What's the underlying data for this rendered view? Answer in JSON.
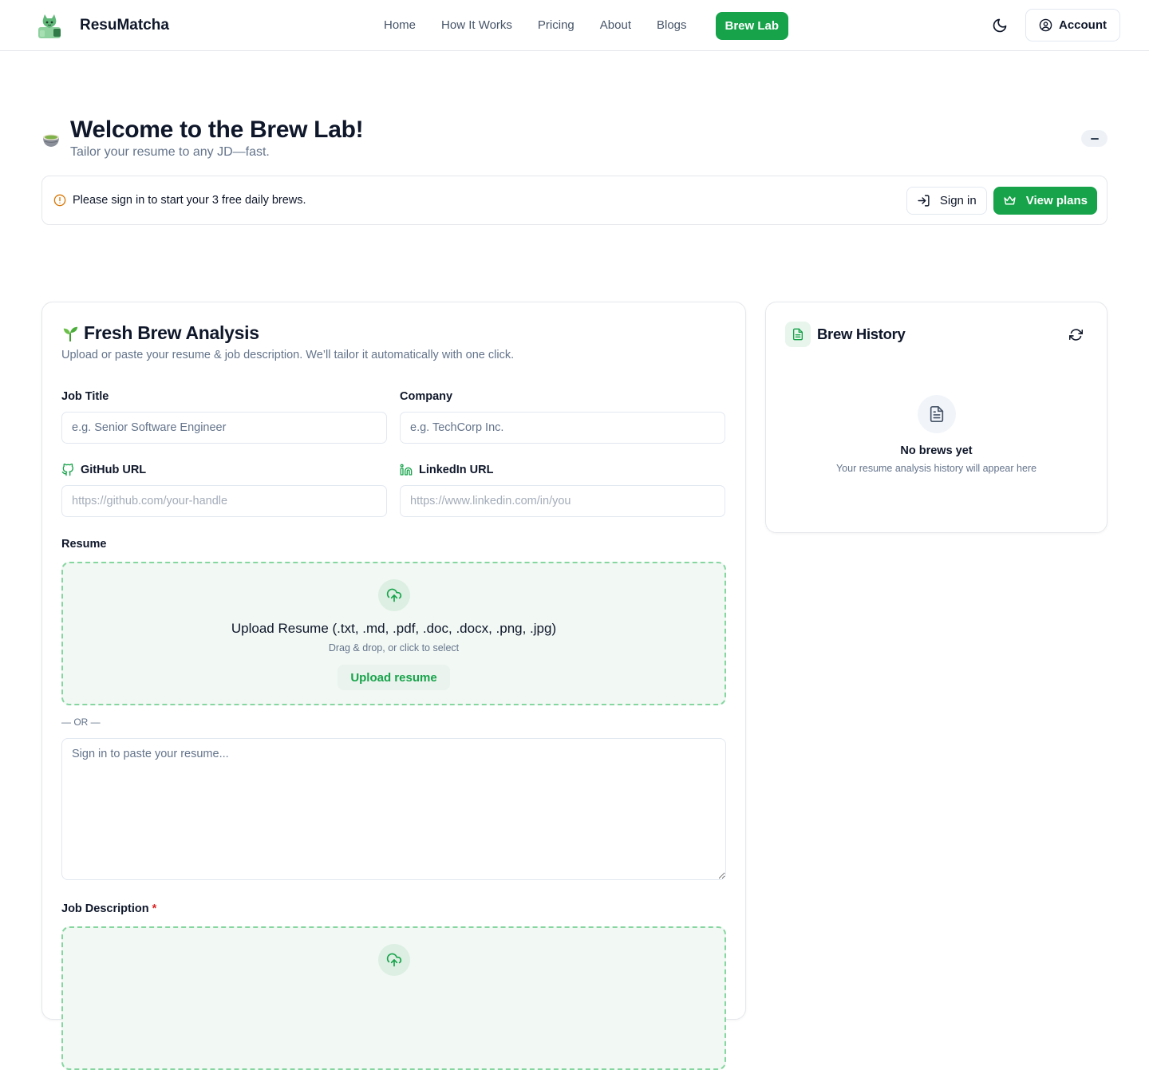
{
  "header": {
    "brand": "ResuMatcha",
    "nav": [
      "Home",
      "How It Works",
      "Pricing",
      "About",
      "Blogs"
    ],
    "nav_active": "Brew Lab",
    "account_label": "Account"
  },
  "welcome": {
    "title": "Welcome to the Brew Lab!",
    "subtitle": "Tailor your resume to any JD—fast."
  },
  "notice": {
    "text": "Please sign in to start your 3 free daily brews.",
    "signin_label": "Sign in",
    "plans_label": "View plans"
  },
  "analysis": {
    "title": "Fresh Brew Analysis",
    "subtitle": "Upload or paste your resume & job description. We’ll tailor it automatically with one click.",
    "job_title_label": "Job Title",
    "job_title_placeholder": "e.g. Senior Software Engineer",
    "company_label": "Company",
    "company_placeholder": "e.g. TechCorp Inc.",
    "github_label": "GitHub URL",
    "github_placeholder": "https://github.com/your-handle",
    "linkedin_label": "LinkedIn URL",
    "linkedin_placeholder": "https://www.linkedin.com/in/you",
    "resume_label": "Resume",
    "resume_drop_title": "Upload Resume (.txt, .md, .pdf, .doc, .docx, .png, .jpg)",
    "resume_drop_sub": "Drag & drop, or click to select",
    "resume_drop_button": "Upload resume",
    "or_text": "— OR —",
    "paste_placeholder": "Sign in to paste your resume...",
    "jd_label": "Job Description",
    "jd_required": "*"
  },
  "history": {
    "title": "Brew History",
    "empty_title": "No brews yet",
    "empty_sub": "Your resume analysis history will appear here"
  },
  "colors": {
    "accent": "#16a34a",
    "warning": "#d97706"
  }
}
